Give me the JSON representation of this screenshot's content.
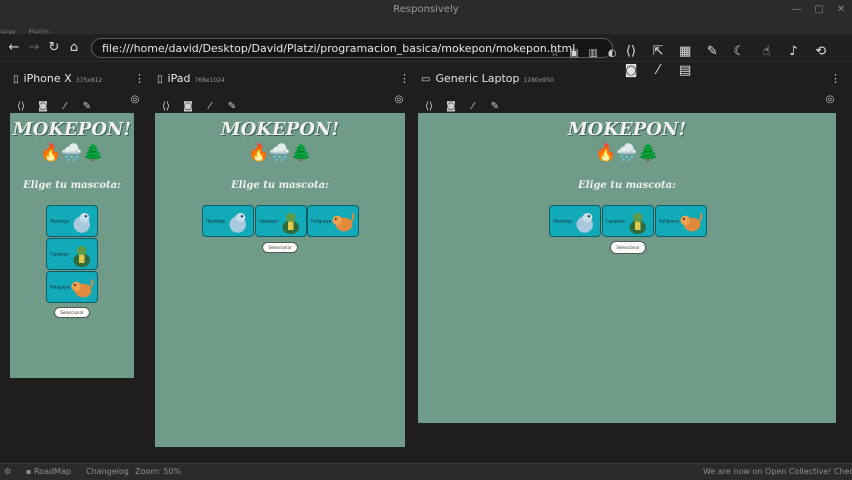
{
  "window": {
    "title": "Responsively"
  },
  "menu": {
    "items": [
      "View",
      "Help"
    ]
  },
  "url": {
    "value": "file:///home/david/Desktop/David/Platzi/programacion_basica/mokepon/mokepon.html"
  },
  "devices": [
    {
      "name": "iPhone X",
      "size": "375x812"
    },
    {
      "name": "iPad",
      "size": "768x1024"
    },
    {
      "name": "Generic Laptop",
      "size": "1280x950"
    }
  ],
  "page": {
    "title": "MOKEPON!",
    "emojis": "🔥🌧️🌲",
    "subtitle": "Elige tu mascota:",
    "pets": [
      "Hipodoge",
      "Capipepo",
      "Ratigueya"
    ],
    "button": "Seleccionar"
  },
  "status": {
    "roadmap": "RoadMap",
    "changelog": "Changelog",
    "zoom": "Zoom: 50%",
    "notice": "We are now on Open Collective! Check it out"
  },
  "colors": {
    "page_bg": "#6f9b88",
    "card_bg": "#12a9b8",
    "app_bg": "#1e1e1e"
  }
}
